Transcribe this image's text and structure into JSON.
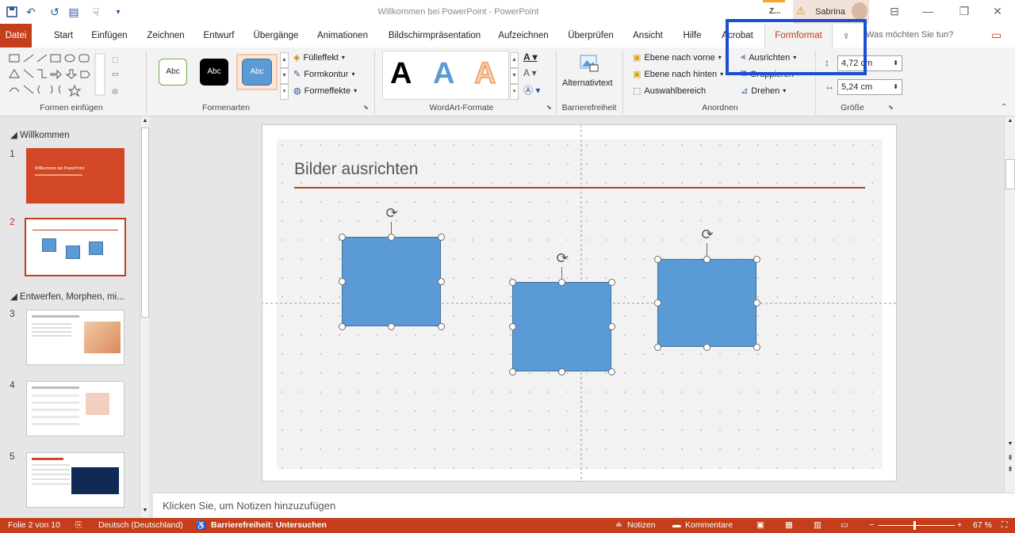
{
  "window": {
    "title": "Willkommen bei PowerPoint - PowerPoint",
    "user_initial_badge": "Z...",
    "user_name": "Sabrina"
  },
  "tabs": [
    "Datei",
    "Start",
    "Einfügen",
    "Zeichnen",
    "Entwurf",
    "Übergänge",
    "Animationen",
    "Bildschirmpräsentation",
    "Aufzeichnen",
    "Überprüfen",
    "Ansicht",
    "Hilfe",
    "Acrobat",
    "Formformat"
  ],
  "tell_me": "Was möchten Sie tun?",
  "ribbon": {
    "groups": {
      "formen_einfuegen": "Formen einfügen",
      "formenarten": "Formenarten",
      "wordart": "WordArt-Formate",
      "barrierefreiheit": "Barrierefreiheit",
      "anordnen": "Anordnen",
      "groesse": "Größe"
    },
    "style_samples": [
      "Abc",
      "Abc",
      "Abc"
    ],
    "fill": "Fülleffekt",
    "outline": "Formkontur",
    "effects": "Formeffekte",
    "wordart_letter": "A",
    "alt_text": "Alternativtext",
    "bring_forward": "Ebene nach vorne",
    "send_backward": "Ebene nach hinten",
    "selection_pane": "Auswahlbereich",
    "align": "Ausrichten",
    "group": "Gruppieren",
    "rotate": "Drehen",
    "height": "4,72 cm",
    "width": "5,24 cm"
  },
  "thumbnails": {
    "section1": "Willkommen",
    "section2": "Entwerfen, Morphen, mi...",
    "numbers": [
      "1",
      "2",
      "3",
      "4",
      "5"
    ],
    "slide1_title": "Willkommen bei PowerPoint"
  },
  "slide": {
    "title": "Bilder ausrichten"
  },
  "notes_placeholder": "Klicken Sie, um Notizen hinzuzufügen",
  "status": {
    "slide_counter": "Folie 2 von 10",
    "language": "Deutsch (Deutschland)",
    "accessibility": "Barrierefreiheit: Untersuchen",
    "notes": "Notizen",
    "comments": "Kommentare",
    "zoom": "67 %"
  },
  "colors": {
    "accent": "#c43e1c",
    "shape_fill": "#5b9bd5",
    "highlight": "#1a4fd1"
  }
}
